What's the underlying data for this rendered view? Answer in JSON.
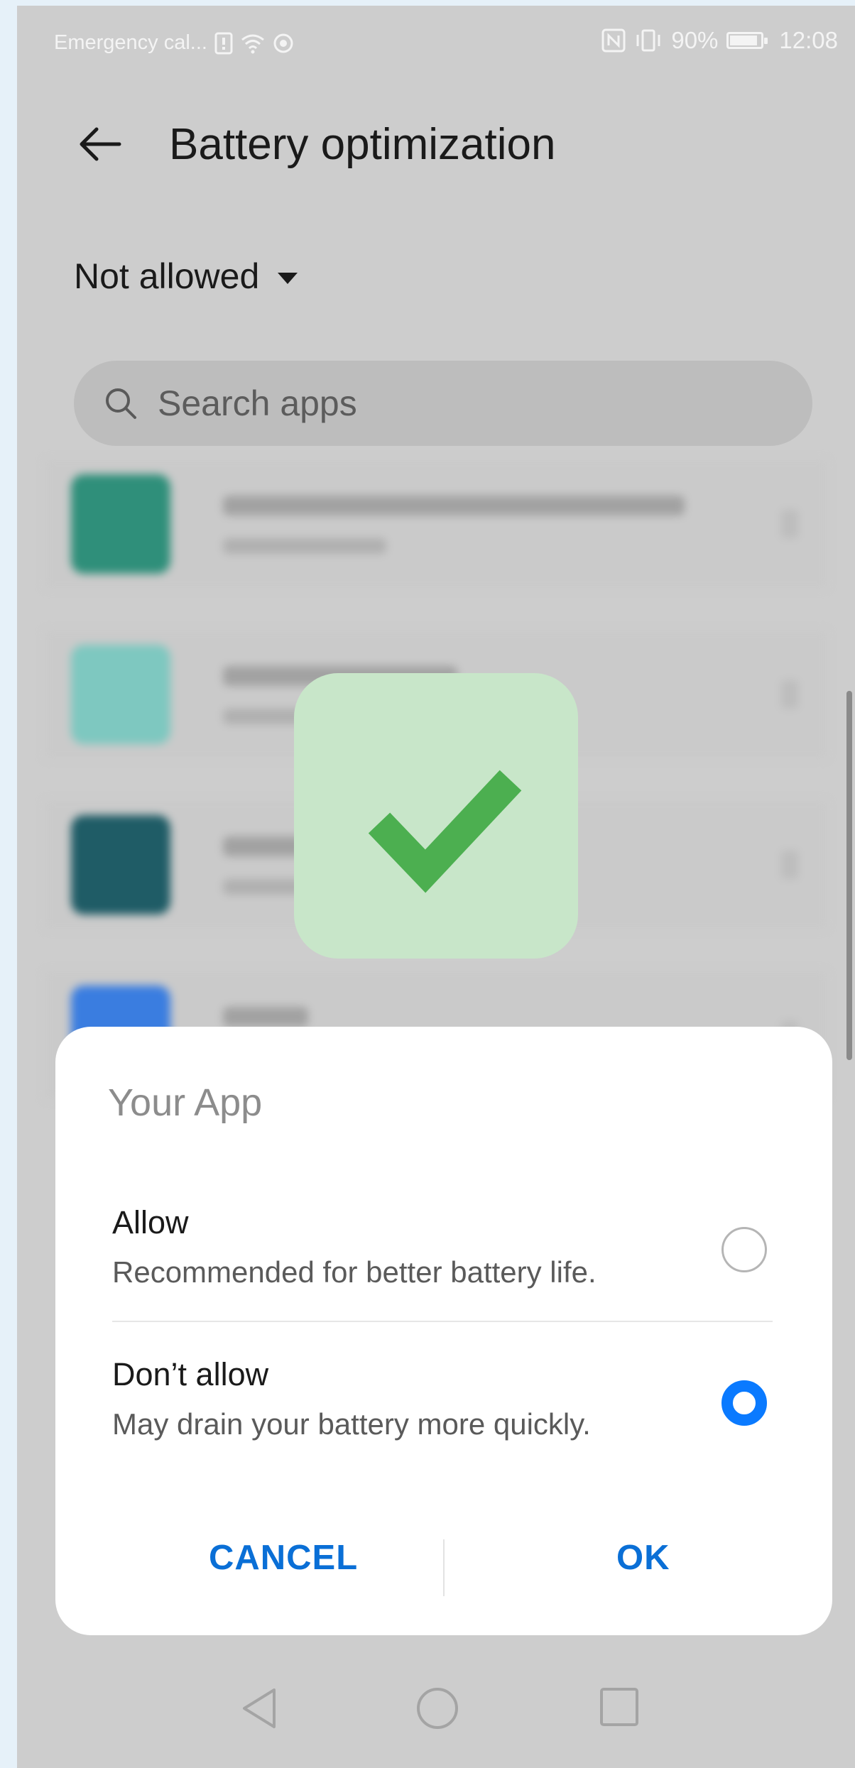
{
  "status_bar": {
    "carrier": "Emergency cal...",
    "battery_percent": "90%",
    "battery_level": 0.9,
    "time": "12:08"
  },
  "header": {
    "title": "Battery optimization",
    "filter_label": "Not allowed"
  },
  "search": {
    "placeholder": "Search apps"
  },
  "dialog": {
    "title": "Your App",
    "options": [
      {
        "label": "Allow",
        "description": "Recommended for better battery life.",
        "selected": false
      },
      {
        "label": "Don’t allow",
        "description": "May drain your battery more quickly.",
        "selected": true
      }
    ],
    "cancel_label": "CANCEL",
    "ok_label": "OK"
  },
  "colors": {
    "accent": "#0a7aff",
    "check": "#4caf50",
    "check_badge_bg": "#c8e6c9",
    "scrim_bg": "#cdcdcd"
  },
  "icons": [
    "back-arrow-icon",
    "caret-down-icon",
    "search-icon",
    "checkmark-icon",
    "nav-back-icon",
    "nav-home-icon",
    "nav-recents-icon"
  ]
}
